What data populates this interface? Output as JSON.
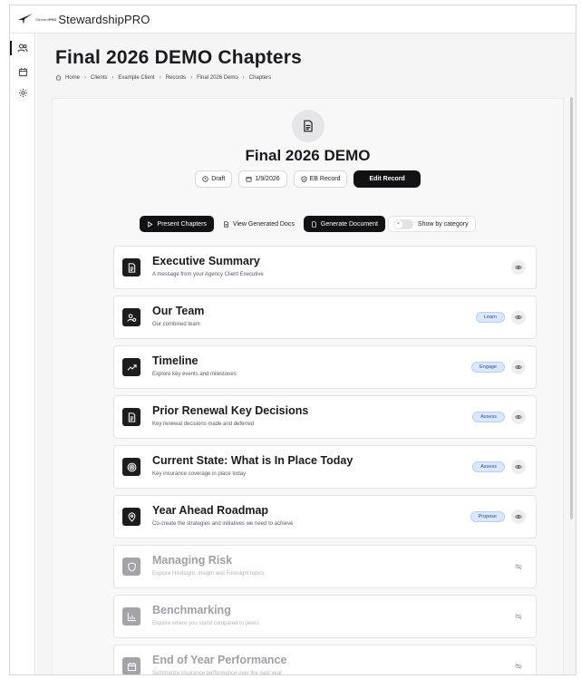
{
  "app": {
    "logo_small_prefix": "Steward",
    "logo_small_bold": "PRO",
    "brand": "StewardshipPRO"
  },
  "rail": [
    {
      "icon": "users-icon"
    },
    {
      "icon": "calendar-icon"
    },
    {
      "icon": "gear-icon"
    }
  ],
  "header": {
    "title": "Final 2026 DEMO Chapters",
    "breadcrumb": [
      "Home",
      "Clients",
      "Example Client",
      "Records",
      "Final 2026 Demo",
      "Chapters"
    ]
  },
  "record": {
    "icon": "document-icon",
    "title": "Final 2026 DEMO",
    "status": "Draft",
    "date": "1/9/2026",
    "type": "EB Record",
    "edit_label": "Edit Record"
  },
  "toolbar": {
    "present": "Present Chapters",
    "view_docs": "View Generated Docs",
    "generate": "Generate Document",
    "toggle_label": "Show by category",
    "toggle_mark": "×"
  },
  "chapters": [
    {
      "title": "Executive Summary",
      "subtitle": "A message from your Agency Client Executive",
      "badge": "",
      "icon": "document-icon",
      "enabled": true
    },
    {
      "title": "Our Team",
      "subtitle": "Our combined team",
      "badge": "Learn",
      "icon": "team-icon",
      "enabled": true
    },
    {
      "title": "Timeline",
      "subtitle": "Explore key events and milestones",
      "badge": "Engage",
      "icon": "trend-icon",
      "enabled": true
    },
    {
      "title": "Prior Renewal Key Decisions",
      "subtitle": "Key renewal decisions made and deferred",
      "badge": "Assess",
      "icon": "document-icon",
      "enabled": true
    },
    {
      "title": "Current State: What is In Place Today",
      "subtitle": "Key insurance coverage in place today",
      "badge": "Assess",
      "icon": "target-icon",
      "enabled": true
    },
    {
      "title": "Year Ahead Roadmap",
      "subtitle": "Co-create the strategies and initiatives we need to achieve",
      "badge": "Propose",
      "icon": "map-pin-icon",
      "enabled": true
    },
    {
      "title": "Managing Risk",
      "subtitle": "Explore Hindsight, Insight and Foresight topics",
      "badge": "",
      "icon": "shield-icon",
      "enabled": false
    },
    {
      "title": "Benchmarking",
      "subtitle": "Explore where you stand compared to peers",
      "badge": "",
      "icon": "bar-chart-icon",
      "enabled": false
    },
    {
      "title": "End of Year Performance",
      "subtitle": "Summarize insurance performance over the past year",
      "badge": "",
      "icon": "calendar-icon",
      "enabled": false
    }
  ],
  "colors": {
    "primary": "#121214",
    "badge_bg": "#dbe7fb",
    "badge_text": "#2a4f8f",
    "page_bg": "#f5f5f6"
  }
}
